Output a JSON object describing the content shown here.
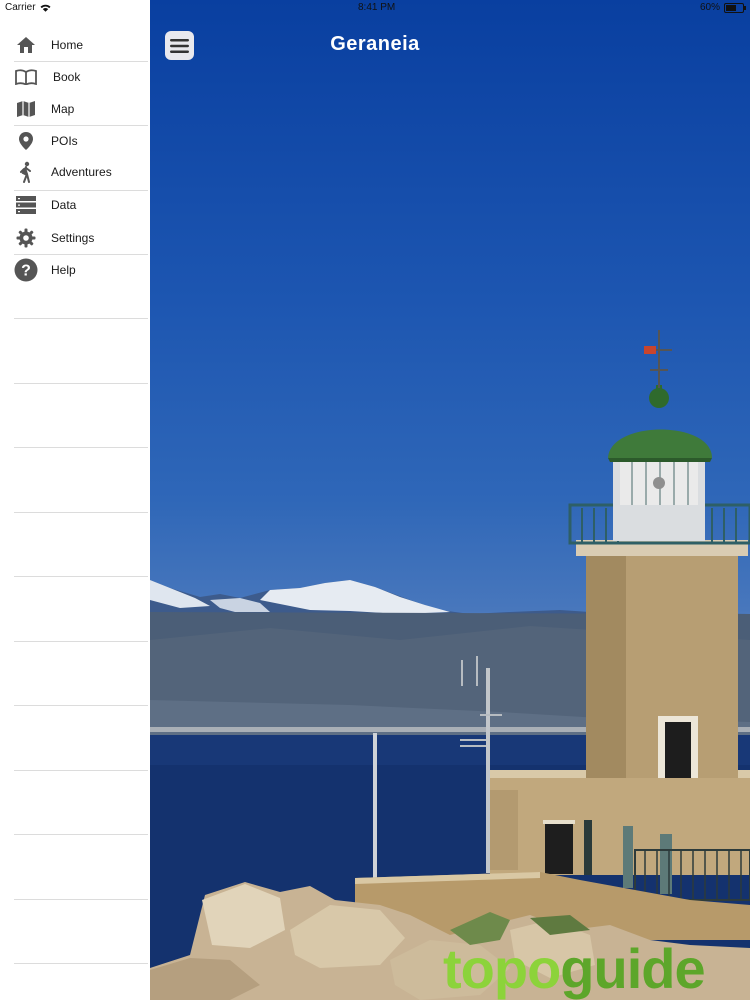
{
  "status": {
    "carrier": "Carrier",
    "time": "8:41 PM",
    "battery": "60%",
    "battery_level": 0.6
  },
  "header": {
    "title": "Geraneia"
  },
  "sidebar": {
    "items": [
      {
        "label": "Home",
        "icon": "home-icon"
      },
      {
        "label": "Book",
        "icon": "book-icon"
      },
      {
        "label": "Map",
        "icon": "map-icon"
      },
      {
        "label": "POIs",
        "icon": "pin-icon"
      },
      {
        "label": "Adventures",
        "icon": "hiker-icon"
      },
      {
        "label": "Data",
        "icon": "data-icon"
      },
      {
        "label": "Settings",
        "icon": "gear-icon"
      },
      {
        "label": "Help",
        "icon": "help-icon"
      }
    ]
  },
  "brand": {
    "part1": "topo",
    "part2": "guide"
  },
  "colors": {
    "sky": "#1a4fae",
    "sea": "#14326e",
    "brand_light": "#8cd33a",
    "brand_dark": "#5da62a",
    "dome": "#3f7a3a"
  }
}
